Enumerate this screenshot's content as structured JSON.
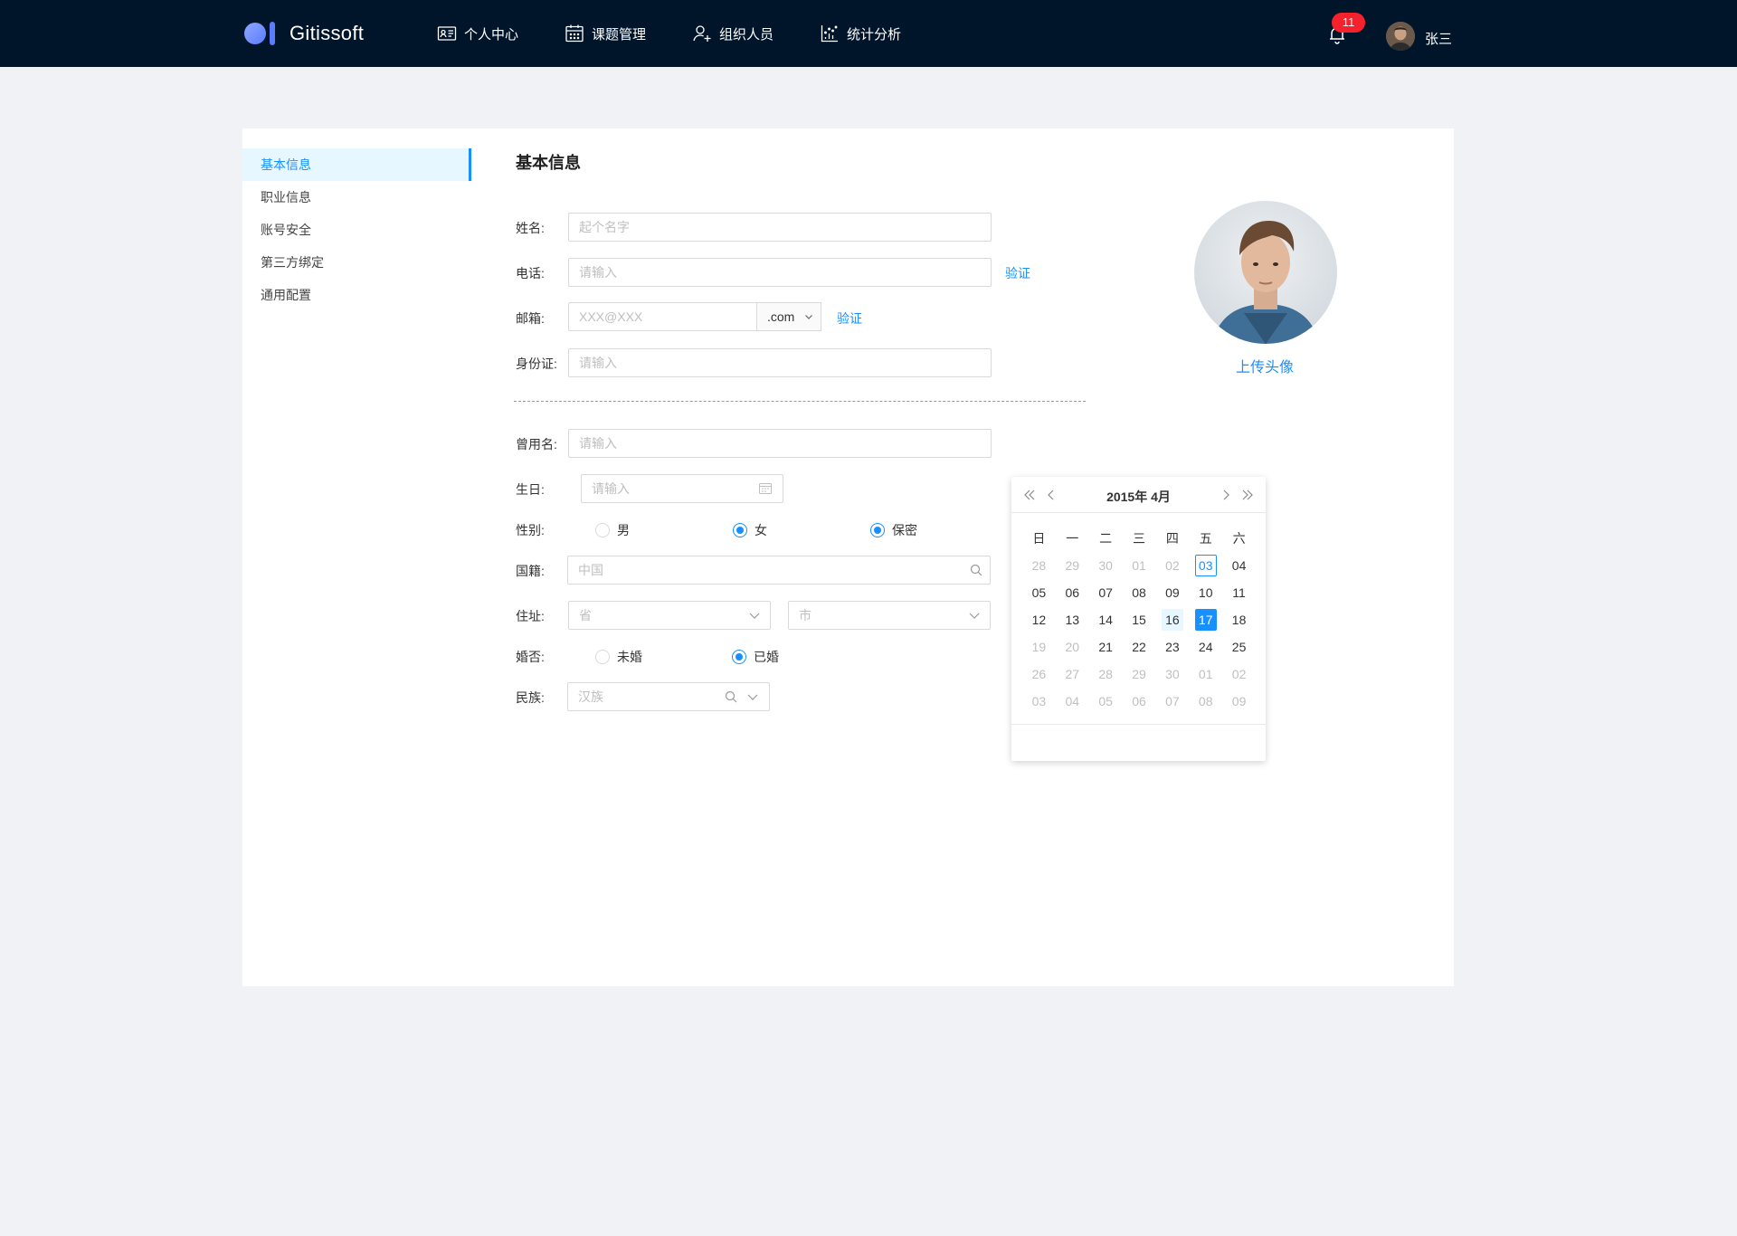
{
  "app": {
    "name": "Gitissoft",
    "colors": {
      "header_bg": "#001529",
      "primary": "#1890ff",
      "badge": "#f5222d",
      "page_bg": "#f0f2f5"
    }
  },
  "nav": {
    "items": [
      {
        "label": "个人中心",
        "icon": "id-card-icon"
      },
      {
        "label": "课题管理",
        "icon": "calendar-icon"
      },
      {
        "label": "组织人员",
        "icon": "user-add-icon"
      },
      {
        "label": "统计分析",
        "icon": "chart-icon"
      }
    ],
    "notifications": {
      "count": "11",
      "icon": "bell-icon"
    },
    "user": {
      "name": "张三"
    }
  },
  "sidebar": {
    "items": [
      {
        "label": "基本信息",
        "active": true
      },
      {
        "label": "职业信息"
      },
      {
        "label": "账号安全"
      },
      {
        "label": "第三方绑定"
      },
      {
        "label": "通用配置"
      }
    ]
  },
  "form": {
    "title": "基本信息",
    "name": {
      "label": "姓名:",
      "placeholder": "起个名字"
    },
    "phone": {
      "label": "电话:",
      "placeholder": "请输入",
      "verify": "验证"
    },
    "email": {
      "label": "邮箱:",
      "placeholder": "XXX@XXX",
      "suffix": ".com",
      "verify": "验证"
    },
    "id_card": {
      "label": "身份证:",
      "placeholder": "请输入"
    },
    "alias": {
      "label": "曾用名:",
      "placeholder": "请输入"
    },
    "birthday": {
      "label": "生日:",
      "placeholder": "请输入"
    },
    "gender": {
      "label": "性别:",
      "options": [
        "男",
        "女",
        "保密"
      ]
    },
    "nationality": {
      "label": "国籍:",
      "placeholder": "中国"
    },
    "address": {
      "label": "住址:",
      "province_placeholder": "省",
      "city_placeholder": "市"
    },
    "marital": {
      "label": "婚否:",
      "options": [
        "未婚",
        "已婚"
      ]
    },
    "ethnicity": {
      "label": "民族:",
      "placeholder": "汉族"
    },
    "avatar": {
      "upload_label": "上传头像"
    }
  },
  "calendar": {
    "title": "2015年 4月",
    "weekdays": [
      "日",
      "一",
      "二",
      "三",
      "四",
      "五",
      "六"
    ],
    "weeks": [
      [
        "28",
        "29",
        "30",
        "01",
        "02",
        "03",
        "04"
      ],
      [
        "05",
        "06",
        "07",
        "08",
        "09",
        "10",
        "11"
      ],
      [
        "12",
        "13",
        "14",
        "15",
        "16",
        "17",
        "18"
      ],
      [
        "19",
        "20",
        "21",
        "22",
        "23",
        "24",
        "25"
      ],
      [
        "26",
        "27",
        "28",
        "29",
        "30",
        "01",
        "02"
      ],
      [
        "03",
        "04",
        "05",
        "06",
        "07",
        "08",
        "09"
      ]
    ]
  }
}
